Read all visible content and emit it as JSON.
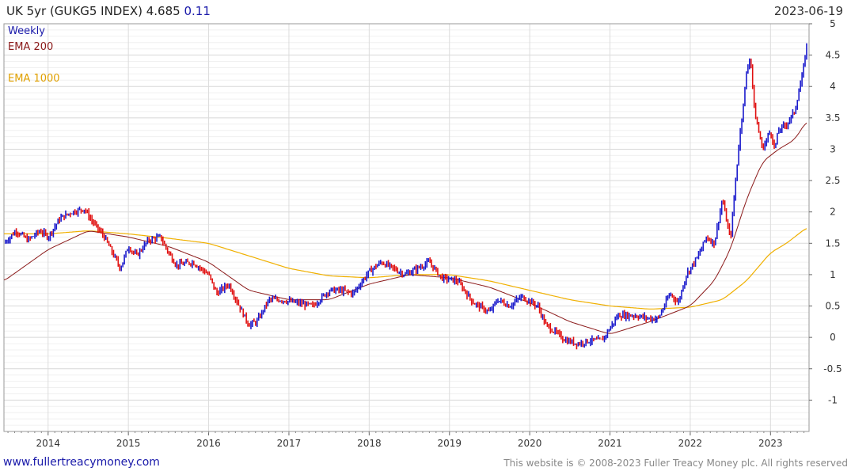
{
  "header": {
    "title": "UK 5yr (GUKG5 INDEX) 4.685",
    "change": "0.11",
    "date": "2023-06-19"
  },
  "legend": {
    "weekly": "Weekly",
    "ema200": "EMA 200",
    "ema1000": "EMA 1000"
  },
  "footer": {
    "left": "www.fullertreacymoney.com",
    "right": "This website is © 2008-2023 Fuller Treacy Money plc. All rights reserved"
  },
  "colors": {
    "up": "#1a1acc",
    "down": "#e01010",
    "ema200": "#8b1a1a",
    "ema1000": "#f0b000",
    "grid": "#e6e6e6"
  },
  "chart_data": {
    "type": "line",
    "title": "UK 5yr (GUKG5 INDEX)",
    "xlabel": "",
    "ylabel": "",
    "x_ticks": [
      "2014",
      "2015",
      "2016",
      "2017",
      "2018",
      "2019",
      "2020",
      "2021",
      "2022",
      "2023"
    ],
    "y_ticks": [
      5,
      4.5,
      4,
      3.5,
      3,
      2.5,
      2,
      1.5,
      1,
      0.5,
      0,
      -0.5,
      -1
    ],
    "y_tick_labels": [
      "5",
      "4.5",
      "4",
      "3.5",
      "3",
      "2.5",
      "2",
      "1.5",
      "1",
      "0.5",
      "0",
      "-0.5",
      "-1"
    ],
    "xlim": [
      2013.45,
      2023.48
    ],
    "ylim": [
      -1.5,
      5
    ],
    "grid": true,
    "legend_position": "top-left",
    "series": [
      {
        "name": "Weekly",
        "x": [
          2013.45,
          2013.6,
          2013.75,
          2013.9,
          2014.0,
          2014.15,
          2014.3,
          2014.45,
          2014.55,
          2014.7,
          2014.8,
          2014.9,
          2015.0,
          2015.1,
          2015.25,
          2015.4,
          2015.5,
          2015.6,
          2015.8,
          2016.0,
          2016.1,
          2016.25,
          2016.4,
          2016.5,
          2016.6,
          2016.75,
          2016.9,
          2017.1,
          2017.3,
          2017.5,
          2017.65,
          2017.8,
          2018.0,
          2018.15,
          2018.3,
          2018.45,
          2018.6,
          2018.75,
          2018.9,
          2019.1,
          2019.3,
          2019.5,
          2019.6,
          2019.75,
          2019.9,
          2020.1,
          2020.2,
          2020.3,
          2020.45,
          2020.6,
          2020.75,
          2020.9,
          2021.1,
          2021.3,
          2021.5,
          2021.6,
          2021.75,
          2021.85,
          2021.95,
          2022.1,
          2022.2,
          2022.3,
          2022.4,
          2022.5,
          2022.6,
          2022.7,
          2022.75,
          2022.8,
          2022.85,
          2022.9,
          2023.0,
          2023.05,
          2023.1,
          2023.2,
          2023.3,
          2023.4,
          2023.45
        ],
        "values": [
          1.5,
          1.7,
          1.55,
          1.7,
          1.6,
          1.9,
          2.0,
          2.05,
          1.85,
          1.6,
          1.35,
          1.1,
          1.45,
          1.3,
          1.55,
          1.6,
          1.35,
          1.15,
          1.2,
          1.0,
          0.7,
          0.85,
          0.45,
          0.2,
          0.25,
          0.6,
          0.6,
          0.55,
          0.5,
          0.75,
          0.75,
          0.7,
          1.05,
          1.2,
          1.1,
          1.0,
          1.1,
          1.2,
          0.95,
          0.9,
          0.55,
          0.4,
          0.6,
          0.5,
          0.65,
          0.5,
          0.2,
          0.1,
          -0.05,
          -0.1,
          -0.05,
          -0.05,
          0.35,
          0.35,
          0.3,
          0.3,
          0.7,
          0.55,
          1.0,
          1.3,
          1.6,
          1.5,
          2.2,
          1.55,
          3.0,
          4.2,
          4.5,
          3.6,
          3.3,
          3.0,
          3.3,
          3.0,
          3.3,
          3.4,
          3.6,
          4.2,
          4.65
        ]
      },
      {
        "name": "EMA 200",
        "x": [
          2013.45,
          2014.0,
          2014.5,
          2015.0,
          2015.5,
          2016.0,
          2016.5,
          2017.0,
          2017.5,
          2018.0,
          2018.5,
          2019.0,
          2019.5,
          2020.0,
          2020.5,
          2021.0,
          2021.5,
          2022.0,
          2022.3,
          2022.5,
          2022.7,
          2022.9,
          2023.1,
          2023.3,
          2023.45
        ],
        "values": [
          0.9,
          1.4,
          1.7,
          1.6,
          1.45,
          1.2,
          0.75,
          0.6,
          0.6,
          0.85,
          1.0,
          0.95,
          0.8,
          0.55,
          0.25,
          0.05,
          0.25,
          0.5,
          0.9,
          1.4,
          2.2,
          2.8,
          3.0,
          3.15,
          3.45
        ]
      },
      {
        "name": "EMA 1000",
        "x": [
          2013.45,
          2014.0,
          2014.5,
          2015.0,
          2015.5,
          2016.0,
          2016.5,
          2017.0,
          2017.5,
          2018.0,
          2018.5,
          2019.0,
          2019.5,
          2020.0,
          2020.5,
          2021.0,
          2021.5,
          2022.0,
          2022.4,
          2022.7,
          2023.0,
          2023.2,
          2023.45
        ],
        "values": [
          1.65,
          1.65,
          1.7,
          1.65,
          1.58,
          1.5,
          1.3,
          1.1,
          0.98,
          0.95,
          1.0,
          1.0,
          0.9,
          0.75,
          0.6,
          0.5,
          0.45,
          0.48,
          0.6,
          0.9,
          1.35,
          1.5,
          1.75
        ]
      }
    ]
  }
}
